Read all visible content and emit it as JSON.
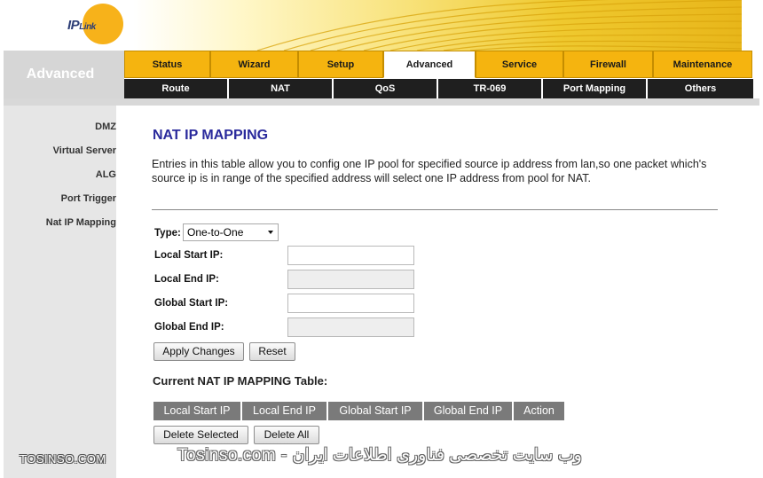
{
  "logo": {
    "brand_big": "IP",
    "brand_small": "Link"
  },
  "sidebar_header": "Advanced",
  "tabs": [
    {
      "label": "Status",
      "active": false
    },
    {
      "label": "Wizard",
      "active": false
    },
    {
      "label": "Setup",
      "active": false
    },
    {
      "label": "Advanced",
      "active": true
    },
    {
      "label": "Service",
      "active": false
    },
    {
      "label": "Firewall",
      "active": false
    },
    {
      "label": "Maintenance",
      "active": false
    }
  ],
  "subnav": [
    "Route",
    "NAT",
    "QoS",
    "TR-069",
    "Port Mapping",
    "Others"
  ],
  "sidebar": [
    "DMZ",
    "Virtual Server",
    "ALG",
    "Port Trigger",
    "Nat IP Mapping"
  ],
  "page": {
    "title": "NAT IP MAPPING",
    "description": "Entries in this table allow you to config one IP pool for specified source ip address from lan,so one packet which's source ip is in range of the specified address will select one IP address from pool for NAT."
  },
  "form": {
    "type_label": "Type:",
    "type_value": "One-to-One",
    "local_start_label": "Local Start IP:",
    "local_start_value": "",
    "local_end_label": "Local End IP:",
    "local_end_value": "",
    "global_start_label": "Global Start IP:",
    "global_start_value": "",
    "global_end_label": "Global End IP:",
    "global_end_value": "",
    "apply_label": "Apply Changes",
    "reset_label": "Reset"
  },
  "table": {
    "title": "Current NAT IP MAPPING Table:",
    "headers": [
      "Local Start IP",
      "Local End IP",
      "Global Start IP",
      "Global End IP",
      "Action"
    ],
    "delete_selected_label": "Delete Selected",
    "delete_all_label": "Delete All"
  },
  "watermark": {
    "left": "TOSINSO.COM",
    "right": "Tosinso.com - وب سایت تخصصی فناوری اطلاعات ایران"
  },
  "colors": {
    "tab_bg": "#f5b40f",
    "subnav_bg": "#1f1f1f",
    "title_color": "#2a2a9c",
    "header_gradient": "#efc92f",
    "table_header_bg": "#7a7a7a"
  }
}
